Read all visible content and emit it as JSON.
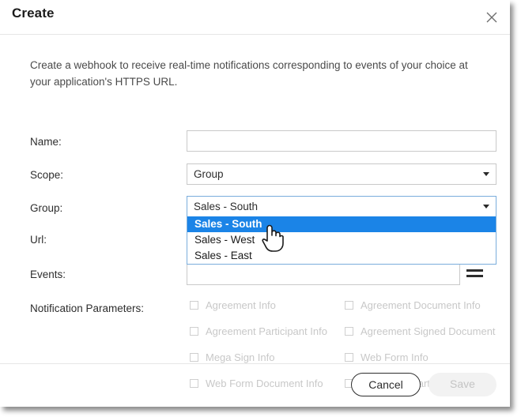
{
  "dialog": {
    "title": "Create",
    "close_icon": "close-icon",
    "description": "Create a webhook to receive real-time notifications corresponding to events of your choice at your application's HTTPS URL."
  },
  "form": {
    "name": {
      "label": "Name:",
      "value": "",
      "placeholder": ""
    },
    "scope": {
      "label": "Scope:",
      "value": "Group",
      "arrow_icon": "chevron-down-icon"
    },
    "group": {
      "label": "Group:",
      "value": "Sales - South",
      "arrow_icon": "chevron-down-icon",
      "expanded": true,
      "options": [
        {
          "label": "Sales - South",
          "selected": true
        },
        {
          "label": "Sales - West",
          "selected": false
        },
        {
          "label": "Sales - East",
          "selected": false
        }
      ]
    },
    "url": {
      "label": "Url:",
      "value": "",
      "placeholder": ""
    },
    "events": {
      "label": "Events:",
      "value": "",
      "placeholder": "",
      "menu_icon": "hamburger-menu-icon"
    },
    "notification_parameters": {
      "label": "Notification Parameters:",
      "disabled": true,
      "rows": [
        [
          {
            "label": "Agreement Info",
            "checked": false
          },
          {
            "label": "Agreement Document Info",
            "checked": false
          }
        ],
        [
          {
            "label": "Agreement Participant Info",
            "checked": false
          },
          {
            "label": "Agreement Signed Document",
            "checked": false
          }
        ],
        [
          {
            "label": "Mega Sign Info",
            "checked": false
          },
          {
            "label": "Web Form Info",
            "checked": false
          }
        ],
        [
          {
            "label": "Web Form Document Info",
            "checked": false
          },
          {
            "label": "Web Form Participant Info",
            "checked": false
          }
        ]
      ]
    }
  },
  "footer": {
    "cancel_label": "Cancel",
    "save_label": "Save",
    "save_disabled": true
  },
  "cursor": {
    "type": "hand-pointer"
  },
  "colors": {
    "highlight_blue": "#1b84e7",
    "focus_border": "#7aaddc",
    "disabled_text": "#c8c8c8",
    "border_gray": "#c9c9c9"
  }
}
